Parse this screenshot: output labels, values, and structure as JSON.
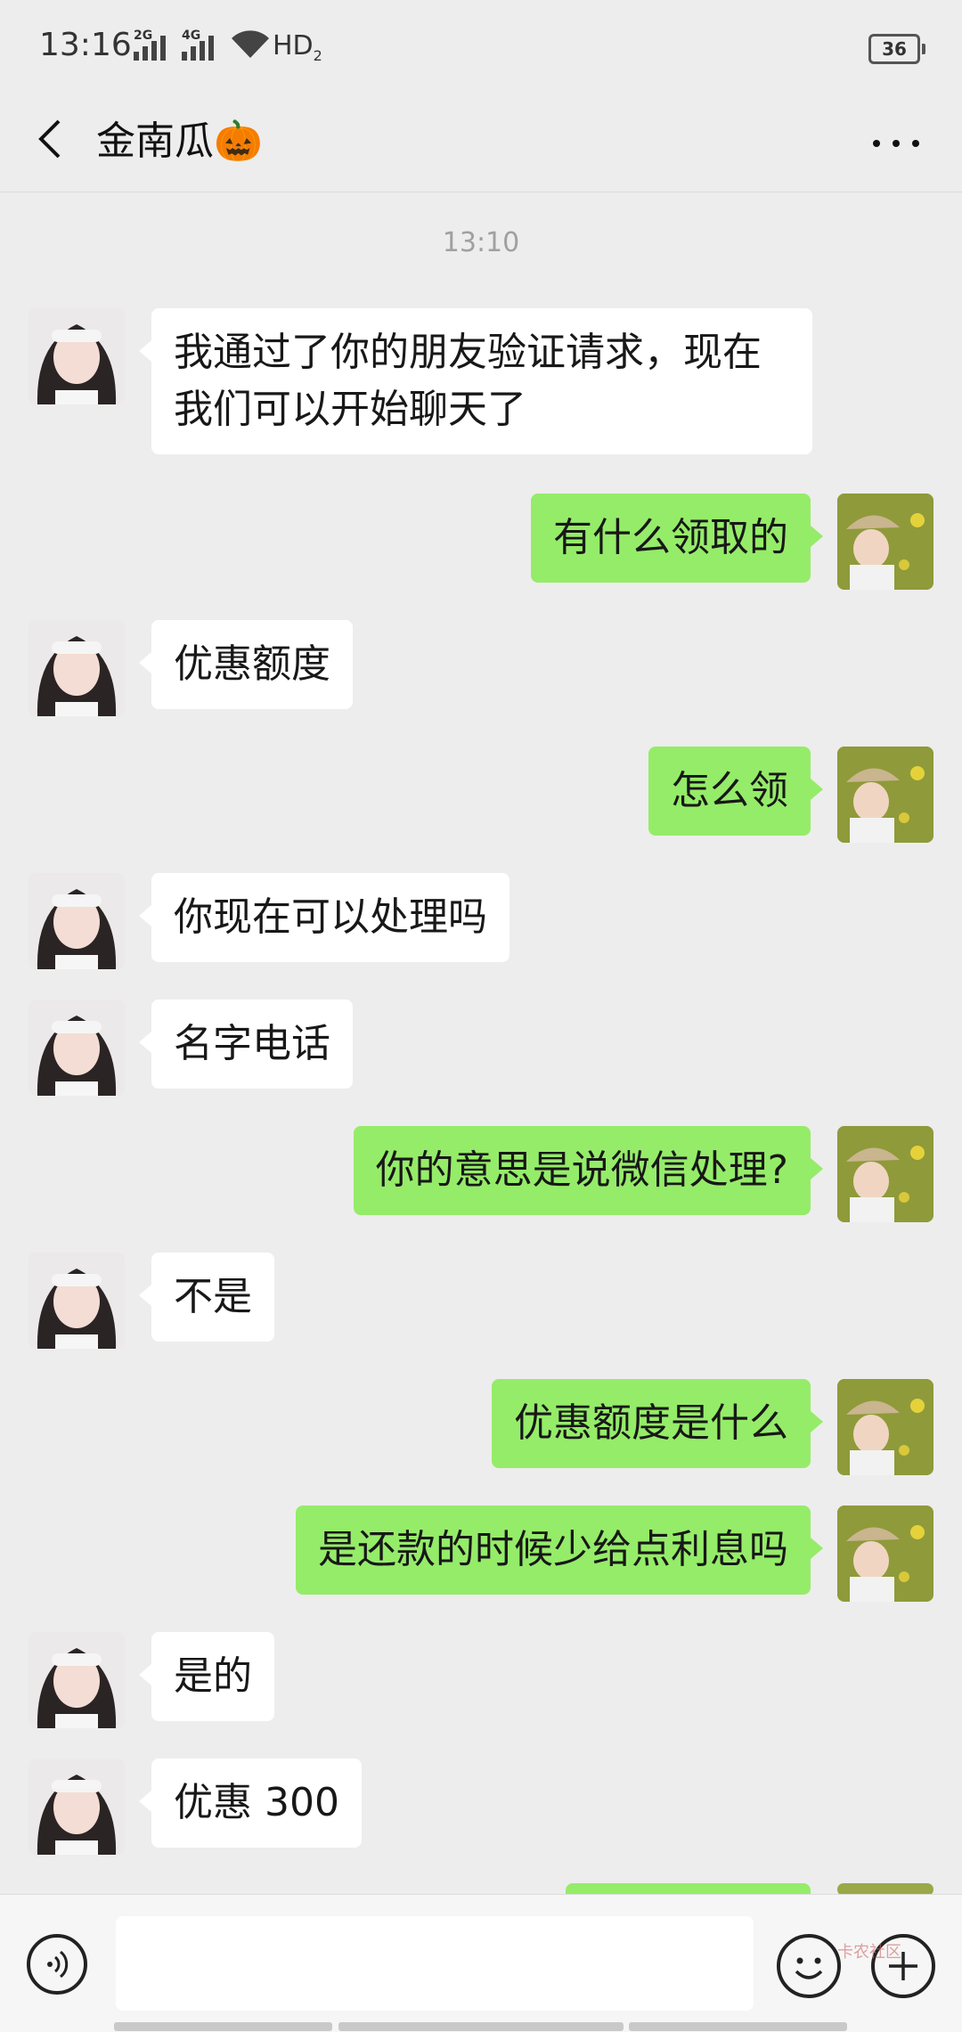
{
  "status": {
    "time": "13:16",
    "sig1": "2G",
    "sig2": "4G",
    "hd": "HD",
    "hd_sub": "2",
    "battery": "36"
  },
  "header": {
    "title": "金南瓜🎃"
  },
  "chat": {
    "timestamp": "13:10",
    "messages": [
      {
        "from": "in",
        "text": "我通过了你的朋友验证请求，现在\n我们可以开始聊天了"
      },
      {
        "from": "out",
        "text": "有什么领取的"
      },
      {
        "from": "in",
        "text": "优惠额度"
      },
      {
        "from": "out",
        "text": "怎么领"
      },
      {
        "from": "in",
        "text": "你现在可以处理吗"
      },
      {
        "from": "in",
        "text": "名字电话"
      },
      {
        "from": "out",
        "text": "你的意思是说微信处理?"
      },
      {
        "from": "in",
        "text": "不是"
      },
      {
        "from": "out",
        "text": "优惠额度是什么"
      },
      {
        "from": "out",
        "text": "是还款的时候少给点利息吗"
      },
      {
        "from": "in",
        "text": "是的"
      },
      {
        "from": "in",
        "text": "优惠 300"
      }
    ]
  },
  "input": {
    "placeholder": "",
    "watermark": "卡农社区"
  },
  "colors": {
    "outgoing_bubble": "#95ec69",
    "incoming_bubble": "#ffffff",
    "background": "#ededed"
  },
  "icons": {
    "back": "chevron-left-icon",
    "more": "more-dots-icon",
    "voice": "voice-icon",
    "emoji": "emoji-icon",
    "plus": "plus-icon"
  }
}
